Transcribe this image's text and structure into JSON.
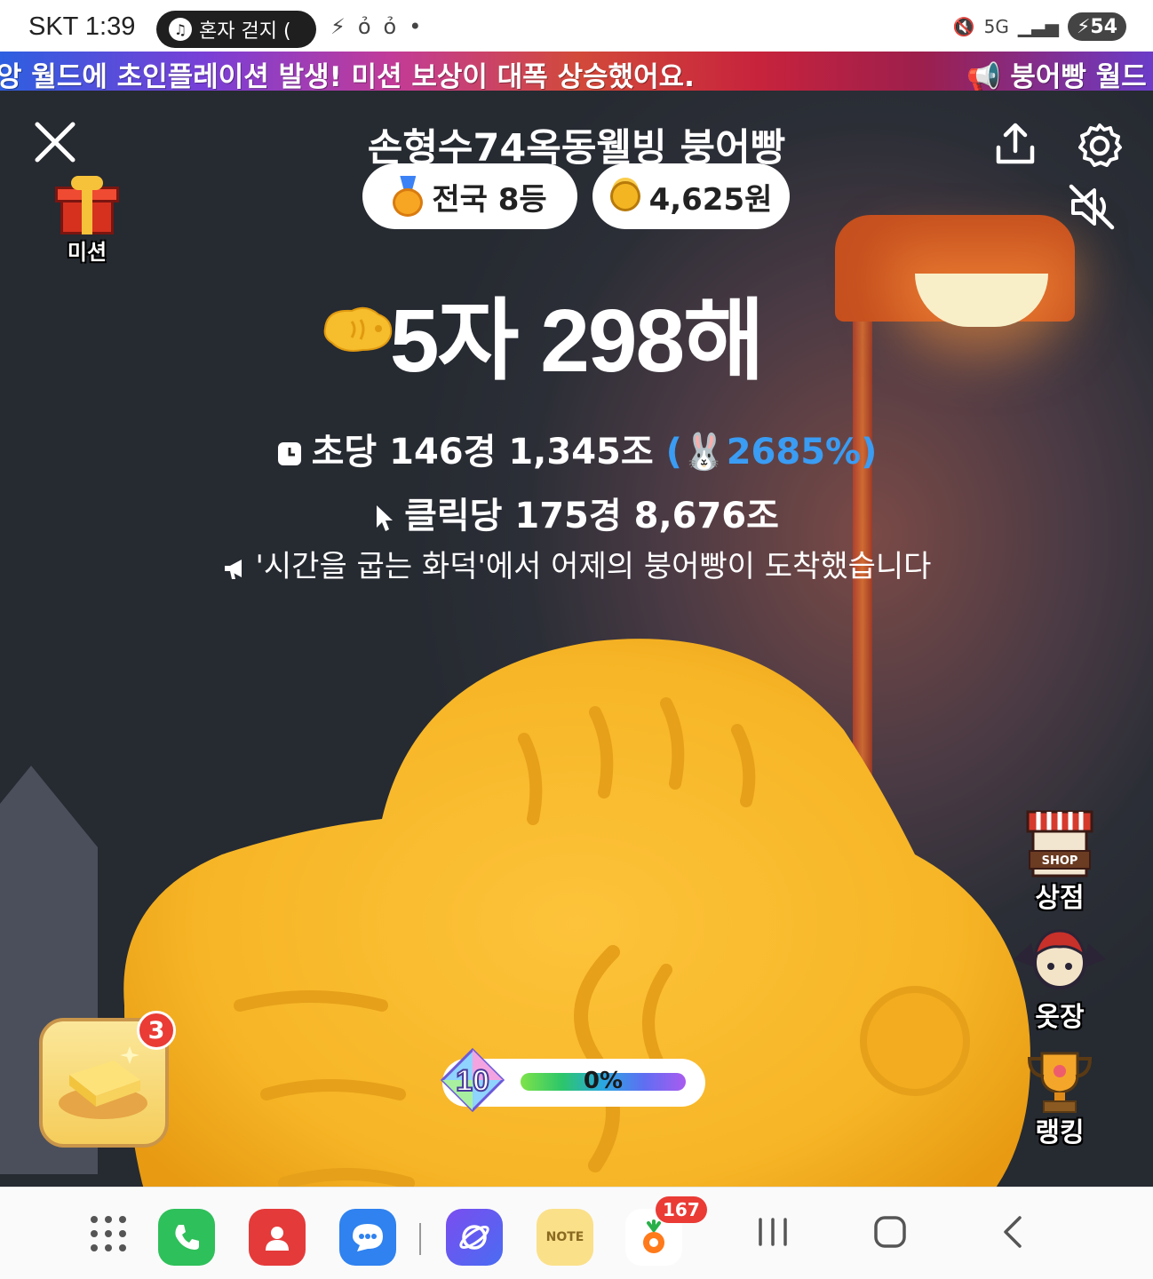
{
  "status_bar": {
    "carrier_time": "SKT 1:39",
    "now_playing": "혼자 걷지 (",
    "battery": "54",
    "network": "5G"
  },
  "banner": {
    "message_a": "앙 월드에 초인플레이션 발생! 미션 보상이 대폭 상승했어요.",
    "message_b": "📢 붕어빵 월드"
  },
  "header": {
    "title": "손형수74옥동웰빙 붕어빵",
    "rank": "전국 8등",
    "money": "4,625원"
  },
  "mission": {
    "label": "미션"
  },
  "counter": {
    "total": "5자 298해"
  },
  "stats": {
    "per_second_label": "초당 146경 1,345조",
    "per_second_boost": "(🐰2685%)",
    "per_click_label": "클릭당 175경 8,676조",
    "notice": "'시간을 굽는 화덕'에서 어제의 붕어빵이 도착했습니다"
  },
  "side_menu": {
    "shop_sign": "SHOP",
    "shop": "상점",
    "closet": "옷장",
    "ranking": "랭킹"
  },
  "butter": {
    "badge": "3"
  },
  "level": {
    "number": "10",
    "progress": "0%",
    "progress_fraction": 0.0
  },
  "navbar": {
    "apps_icon": "apps-grid-icon",
    "phone_icon": "phone-icon",
    "contacts_icon": "contacts-icon",
    "messages_icon": "messages-icon",
    "internet_icon": "internet-icon",
    "note_label": "NOTE",
    "carrot_badge": "167"
  },
  "colors": {
    "boost": "#3a9cf3",
    "badge": "#ea3b35",
    "pill_bg": "#ffffff"
  }
}
